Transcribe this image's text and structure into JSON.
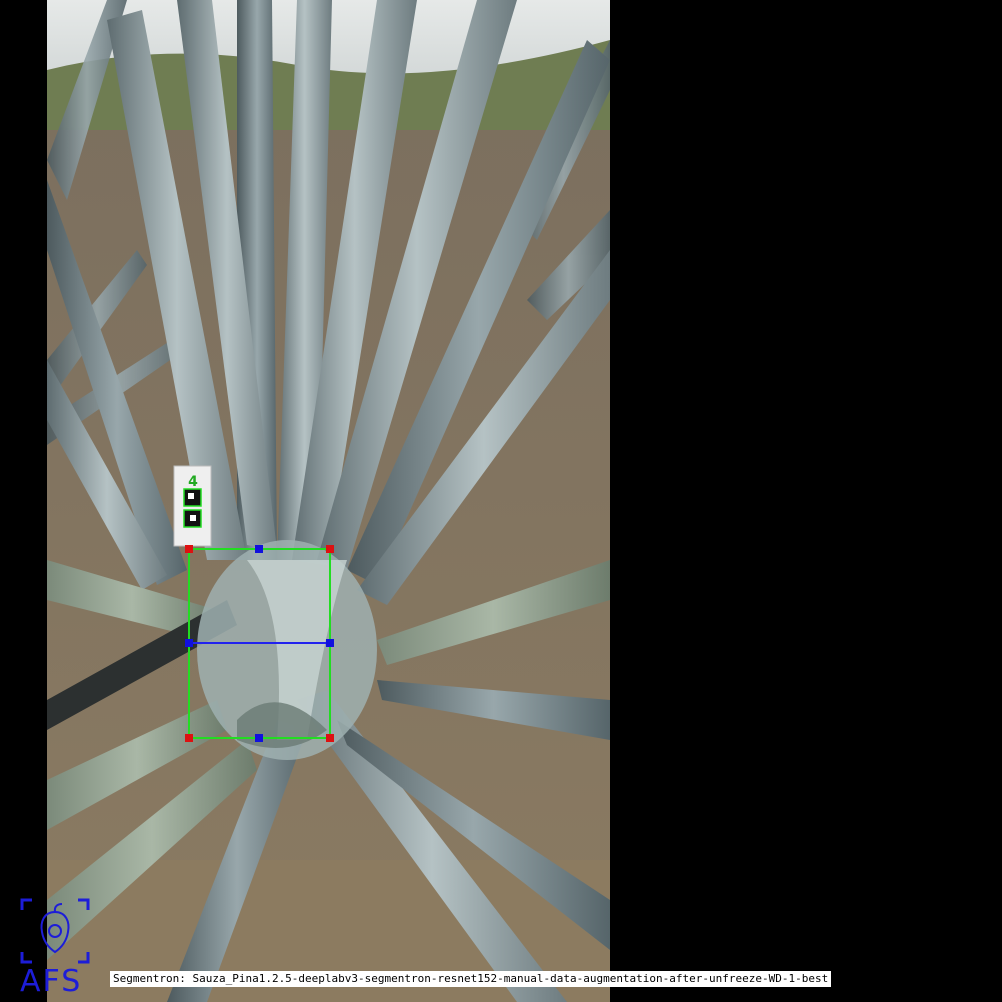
{
  "image": {
    "subject": "agave",
    "background_color": "#000000"
  },
  "marker_card": {
    "number": "4"
  },
  "detection": {
    "box_color": "#22dd22",
    "corner_color": "#dd1111",
    "midpoint_color": "#1111dd",
    "midline_color": "#2222ee"
  },
  "logo": {
    "text": "AFS",
    "color": "#1d1dd8"
  },
  "caption": {
    "text": "Segmentron: Sauza_Pina1.2.5-deeplabv3-segmentron-resnet152-manual-data-augmentation-after-unfreeze-WD-1-best"
  }
}
